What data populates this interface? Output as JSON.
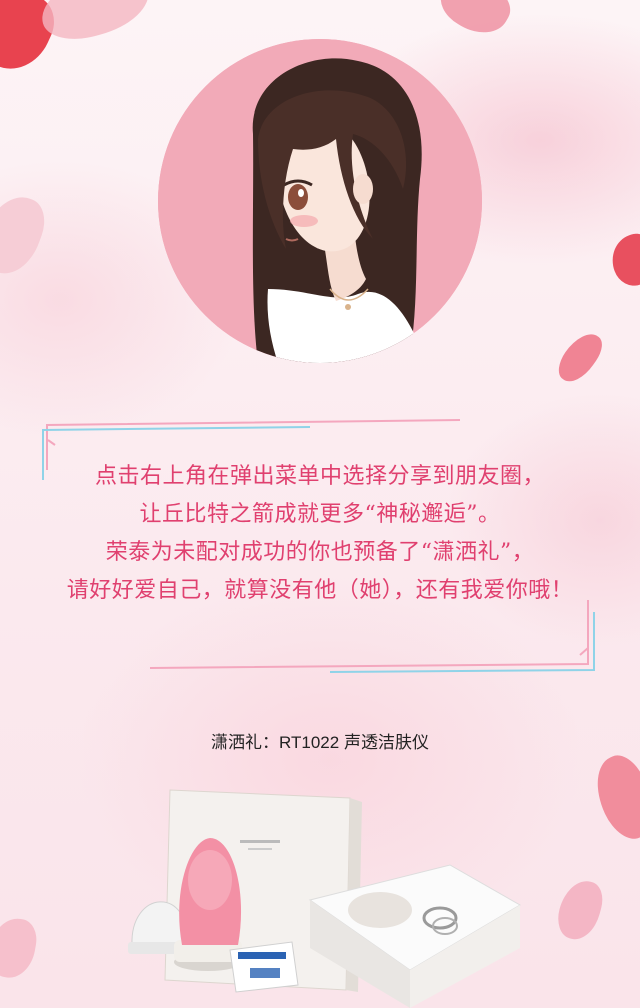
{
  "message": {
    "lines": [
      "点击右上角在弹出菜单中选择分享到朋友圈，",
      "让丘比特之箭成就更多“神秘邂逅”。",
      "荣泰为未配对成功的你也预备了“潇洒礼”，",
      "请好好爱自己，就算没有他（她），还有我爱你哦！"
    ]
  },
  "gift": {
    "label": "潇洒礼：RT1022 声透洁肤仪"
  },
  "colors": {
    "accent": "#e0406f",
    "avatar_bg": "#f2aab8",
    "frame_pink": "#f4a7be",
    "frame_blue": "#8fd3e8"
  }
}
